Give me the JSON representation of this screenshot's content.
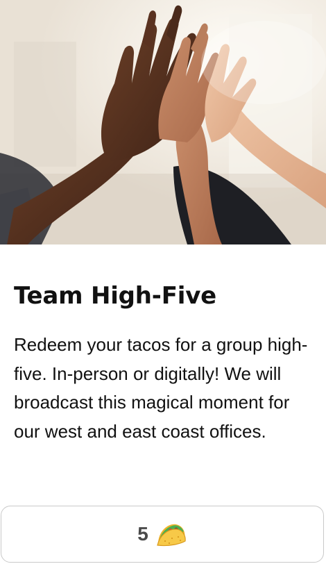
{
  "card": {
    "image": {
      "icon": "high-five-photo"
    },
    "title": "Team High-Five",
    "description": "Redeem your tacos for a group high-five. In-person or digitally! We will broadcast this magical moment for our west and east coast offices.",
    "price": {
      "amount": "5",
      "icon": "taco-icon"
    }
  },
  "colors": {
    "text": "#111111",
    "price_text": "#4a4a4a",
    "button_border": "#c9c9c9",
    "background": "#ffffff"
  }
}
